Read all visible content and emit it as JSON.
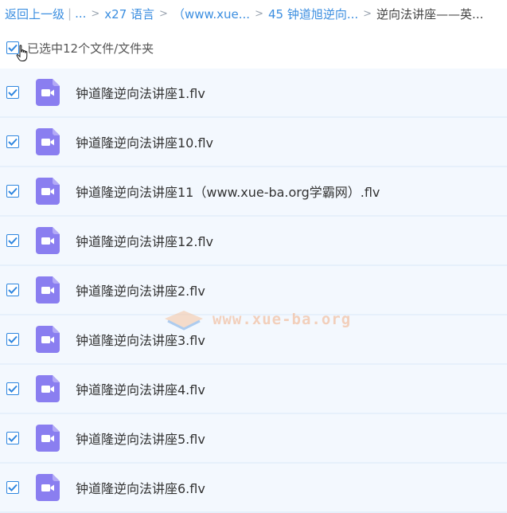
{
  "breadcrumb": {
    "back": "返回上一级",
    "pipe": "|",
    "ellipsis": "...",
    "separator": ">",
    "items": [
      "x27 语言",
      "（www.xue...",
      "45 钟道旭逆向...",
      "逆向法讲座——英..."
    ]
  },
  "selection": {
    "label": "已选中12个文件/文件夹",
    "checked": true
  },
  "watermark": {
    "text": "www.xue-ba.org"
  },
  "colors": {
    "accent": "#2e86df",
    "link": "#3b8ee0",
    "row_bg": "#f3f8fe",
    "video_icon": "#8a7ef0"
  },
  "files": [
    {
      "name": "钟道隆逆向法讲座1.flv",
      "icon": "video-file-icon",
      "checked": true
    },
    {
      "name": "钟道隆逆向法讲座10.flv",
      "icon": "video-file-icon",
      "checked": true
    },
    {
      "name": "钟道隆逆向法讲座11（www.xue-ba.org学霸网）.flv",
      "icon": "video-file-icon",
      "checked": true
    },
    {
      "name": "钟道隆逆向法讲座12.flv",
      "icon": "video-file-icon",
      "checked": true
    },
    {
      "name": "钟道隆逆向法讲座2.flv",
      "icon": "video-file-icon",
      "checked": true
    },
    {
      "name": "钟道隆逆向法讲座3.flv",
      "icon": "video-file-icon",
      "checked": true
    },
    {
      "name": "钟道隆逆向法讲座4.flv",
      "icon": "video-file-icon",
      "checked": true
    },
    {
      "name": "钟道隆逆向法讲座5.flv",
      "icon": "video-file-icon",
      "checked": true
    },
    {
      "name": "钟道隆逆向法讲座6.flv",
      "icon": "video-file-icon",
      "checked": true
    }
  ]
}
